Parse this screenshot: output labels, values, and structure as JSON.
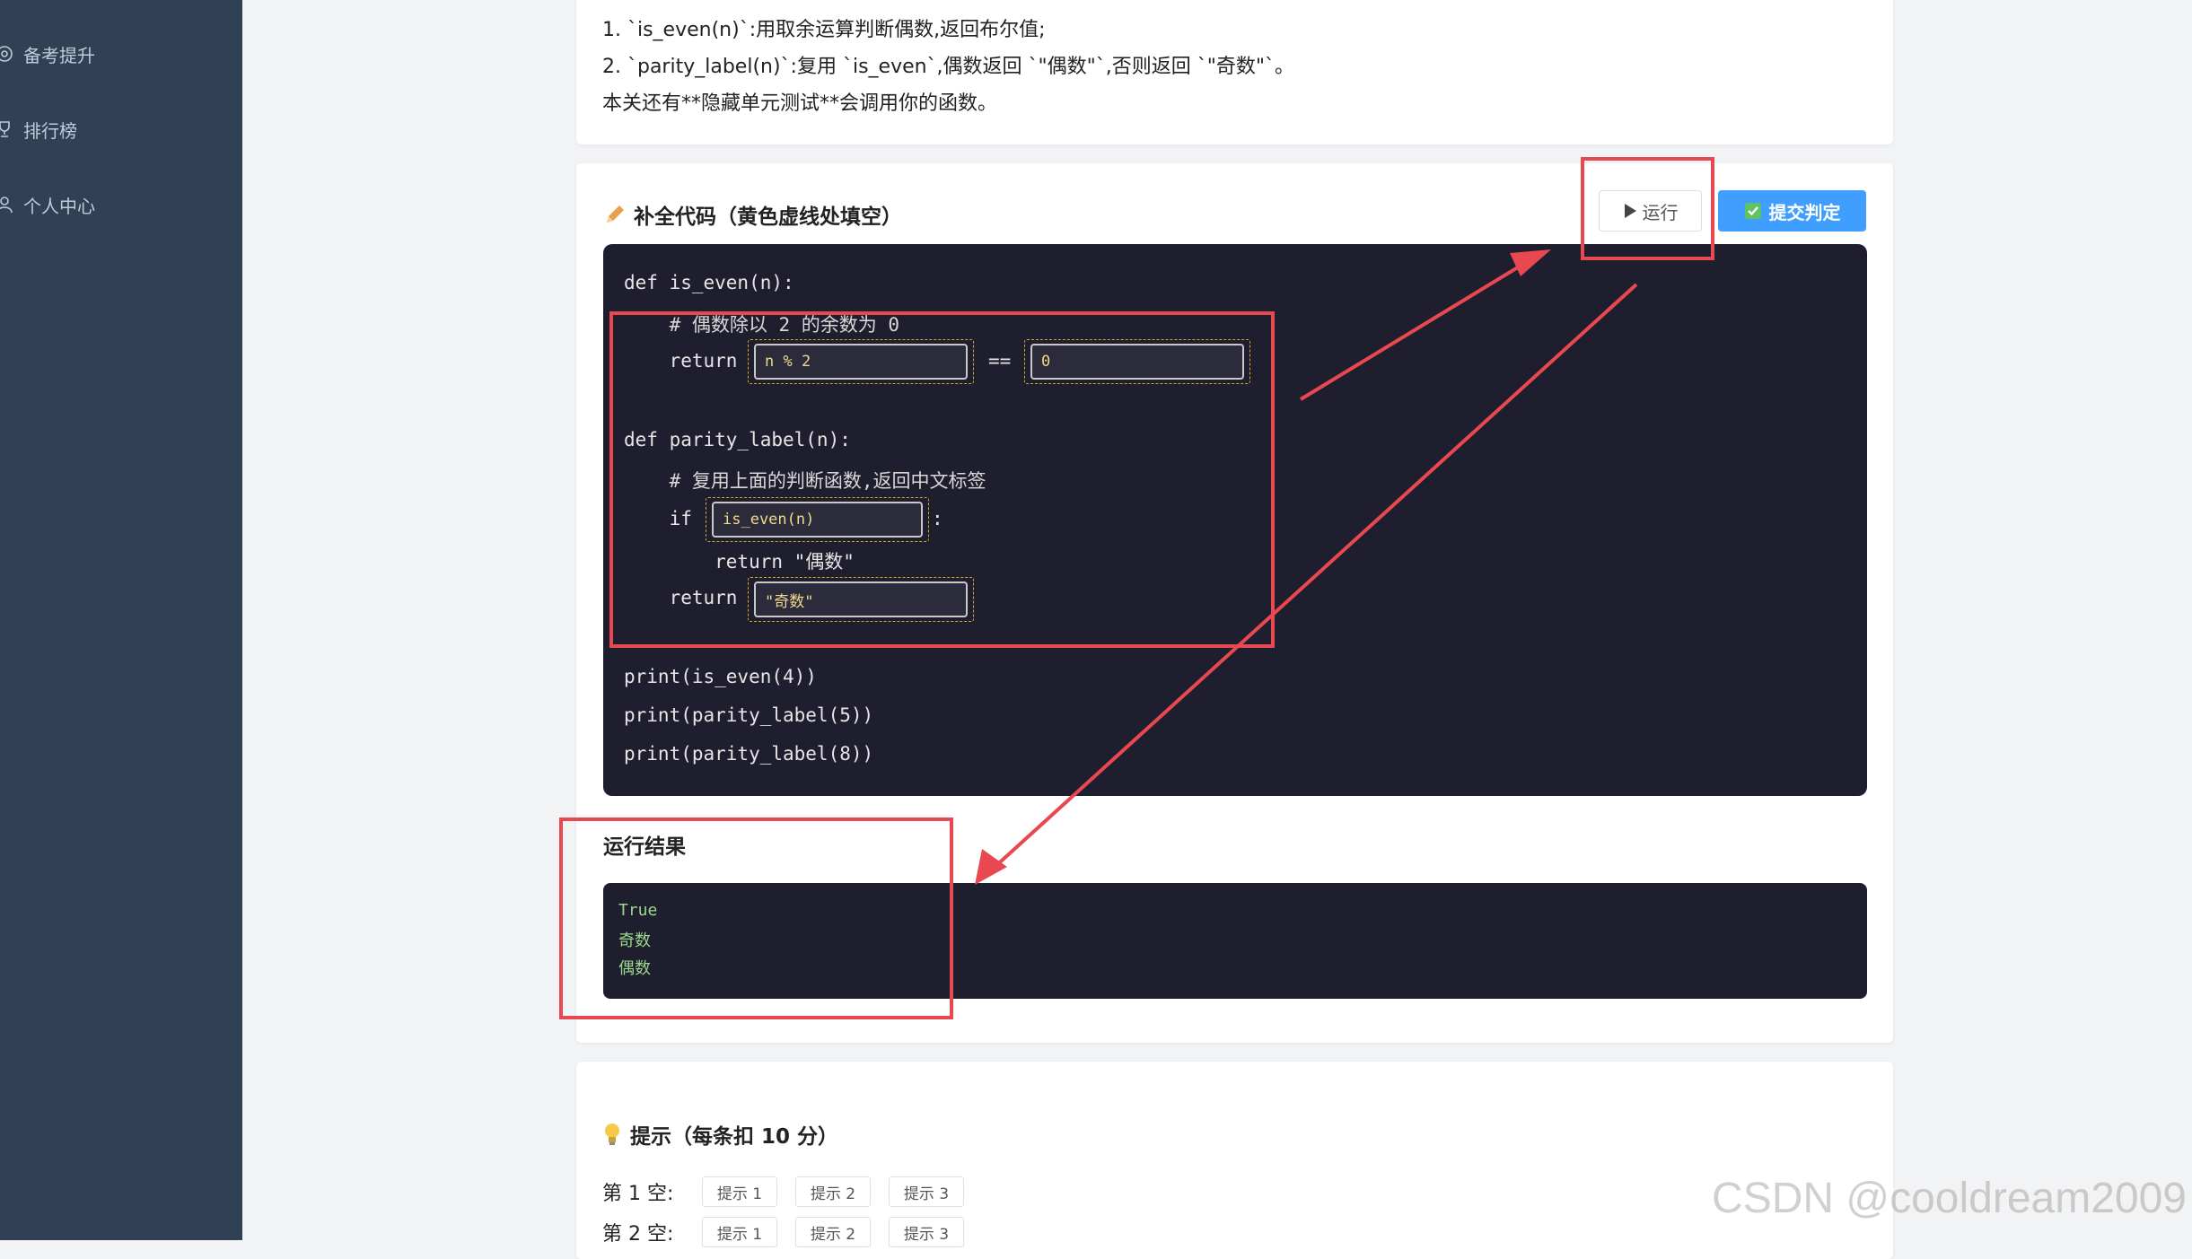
{
  "sidebar": {
    "items": [
      {
        "label": "备考提升",
        "icon": "target-icon"
      },
      {
        "label": "排行榜",
        "icon": "trophy-icon"
      },
      {
        "label": "个人中心",
        "icon": "user-icon"
      }
    ]
  },
  "description": {
    "line1": "1. `is_even(n)`:用取余运算判断偶数,返回布尔值;",
    "line2": "2. `parity_label(n)`:复用 `is_even`,偶数返回 `\"偶数\"`,否则返回 `\"奇数\"`。",
    "line3": "本关还有**隐藏单元测试**会调用你的函数。"
  },
  "editor_card": {
    "title": "补全代码（黄色虚线处填空）",
    "run_label": "运行",
    "submit_label": "提交判定",
    "code": {
      "l1": "def is_even(n):",
      "l2": "    # 偶数除以 2 的余数为 0",
      "l3_kw": "    return",
      "l3_op": "==",
      "l4": "def parity_label(n):",
      "l5": "    # 复用上面的判断函数,返回中文标签",
      "l6_kw": "    if",
      "l6_colon": ":",
      "l7": "        return \"偶数\"",
      "l8_kw": "    return",
      "l9": "print(is_even(4))",
      "l10": "print(parity_label(5))",
      "l11": "print(parity_label(8))"
    },
    "blanks": {
      "b1": "n % 2",
      "b2": "0",
      "b3": "is_even(n)",
      "b4": "\"奇数\""
    },
    "result_title": "运行结果",
    "output": [
      "True",
      "奇数",
      "偶数"
    ]
  },
  "hints_card": {
    "title": "提示（每条扣 10 分）",
    "rows": [
      {
        "label": "第 1 空:",
        "buttons": [
          "提示 1",
          "提示 2",
          "提示 3"
        ]
      },
      {
        "label": "第 2 空:",
        "buttons": [
          "提示 1",
          "提示 2",
          "提示 3"
        ]
      }
    ]
  },
  "watermark": "CSDN @cooldream2009",
  "colors": {
    "sidebar": "#304156",
    "editor_bg": "#1e1e2e",
    "primary": "#409eff",
    "annotation": "#e8484f",
    "blank_border": "#d4a72c"
  }
}
